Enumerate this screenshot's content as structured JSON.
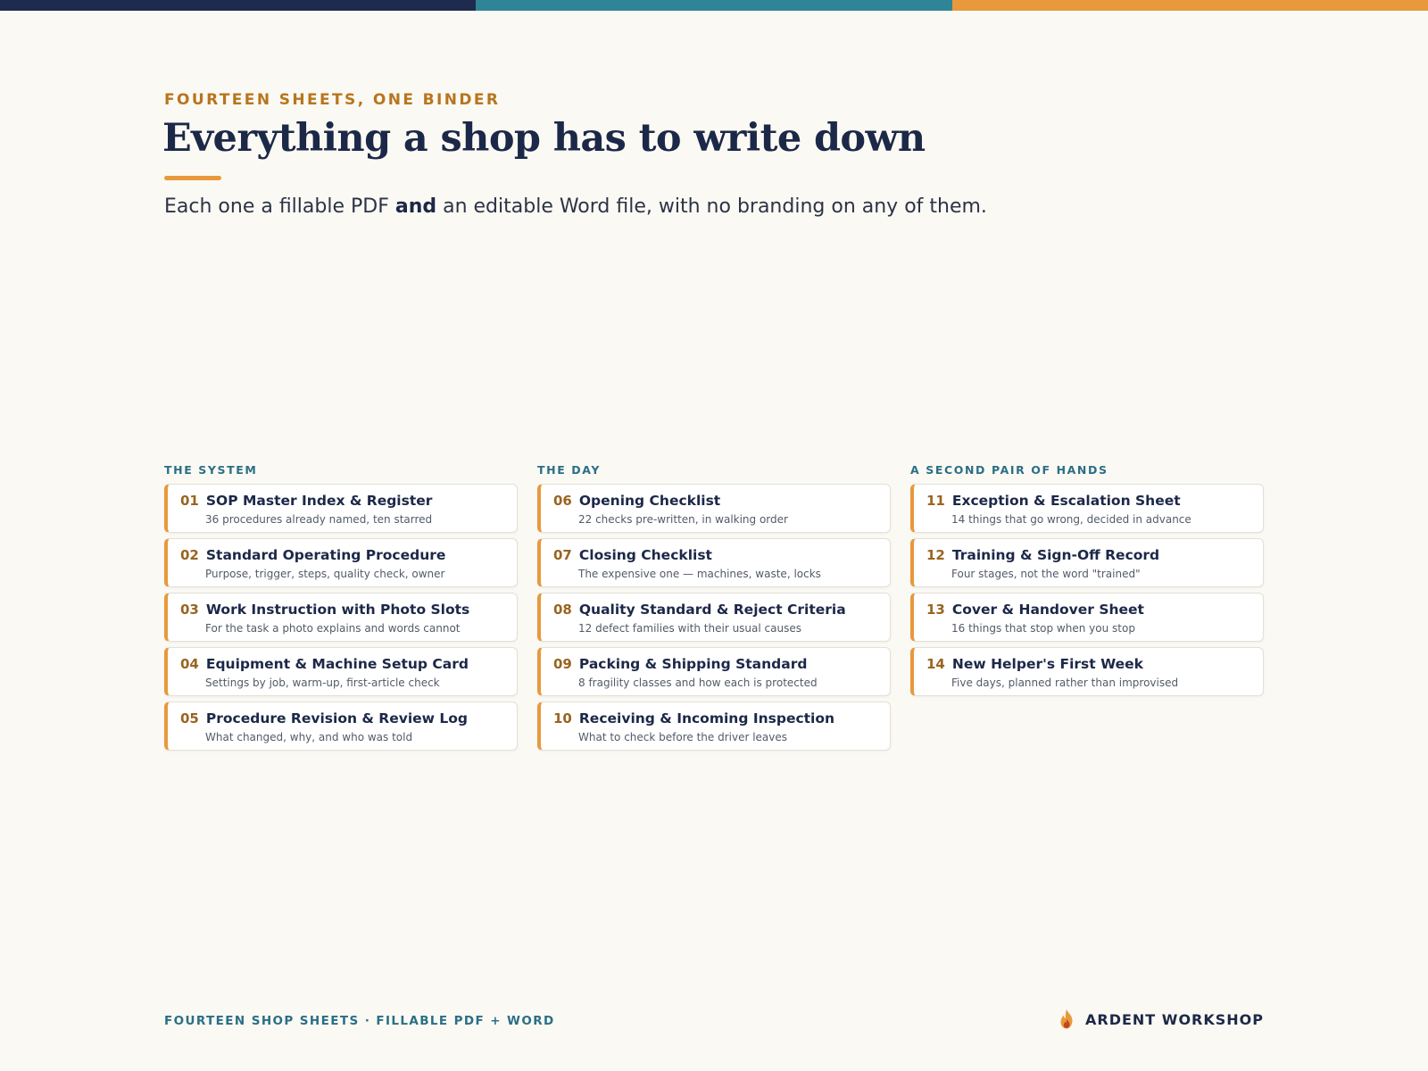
{
  "colors": {
    "navy": "#1e2b4f",
    "teal": "#2f8496",
    "orange": "#e8993c",
    "background": "#fbf9f3"
  },
  "header": {
    "eyebrow": "FOURTEEN SHEETS, ONE BINDER",
    "title": "Everything a shop has to write down",
    "subtitle_before": "Each one a fillable PDF ",
    "subtitle_strong": "and",
    "subtitle_after": " an editable Word file, with no branding on any of them."
  },
  "columns": [
    {
      "heading": "THE SYSTEM",
      "items": [
        {
          "num": "01",
          "title": "SOP Master Index & Register",
          "subtitle": "36 procedures already named, ten starred"
        },
        {
          "num": "02",
          "title": "Standard Operating Procedure",
          "subtitle": "Purpose, trigger, steps, quality check, owner"
        },
        {
          "num": "03",
          "title": "Work Instruction with Photo Slots",
          "subtitle": "For the task a photo explains and words cannot"
        },
        {
          "num": "04",
          "title": "Equipment & Machine Setup Card",
          "subtitle": "Settings by job, warm-up, first-article check"
        },
        {
          "num": "05",
          "title": "Procedure Revision & Review Log",
          "subtitle": "What changed, why, and who was told"
        }
      ]
    },
    {
      "heading": "THE DAY",
      "items": [
        {
          "num": "06",
          "title": "Opening Checklist",
          "subtitle": "22 checks pre-written, in walking order"
        },
        {
          "num": "07",
          "title": "Closing Checklist",
          "subtitle": "The expensive one — machines, waste, locks"
        },
        {
          "num": "08",
          "title": "Quality Standard & Reject Criteria",
          "subtitle": "12 defect families with their usual causes"
        },
        {
          "num": "09",
          "title": "Packing & Shipping Standard",
          "subtitle": "8 fragility classes and how each is protected"
        },
        {
          "num": "10",
          "title": "Receiving & Incoming Inspection",
          "subtitle": "What to check before the driver leaves"
        }
      ]
    },
    {
      "heading": "A SECOND PAIR OF HANDS",
      "items": [
        {
          "num": "11",
          "title": "Exception & Escalation Sheet",
          "subtitle": "14 things that go wrong, decided in advance"
        },
        {
          "num": "12",
          "title": "Training & Sign-Off Record",
          "subtitle": "Four stages, not the word \"trained\""
        },
        {
          "num": "13",
          "title": "Cover & Handover Sheet",
          "subtitle": "16 things that stop when you stop"
        },
        {
          "num": "14",
          "title": "New Helper's First Week",
          "subtitle": "Five days, planned rather than improvised"
        }
      ]
    }
  ],
  "footer": {
    "left_text": "FOURTEEN SHOP SHEETS · FILLABLE PDF + WORD",
    "brand_name": "ARDENT WORKSHOP",
    "brand_icon": "flame-icon"
  }
}
